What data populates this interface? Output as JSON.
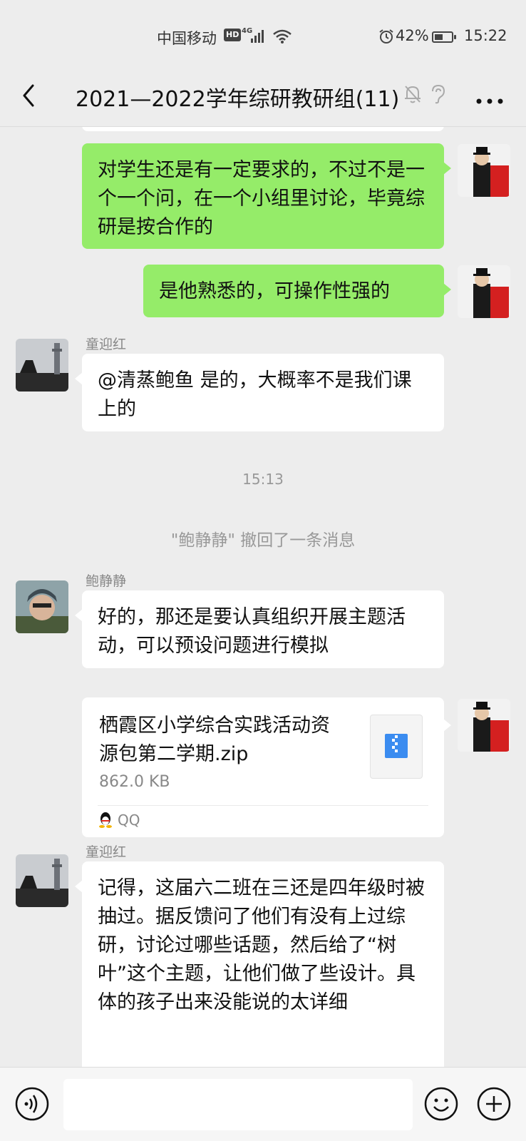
{
  "status_bar": {
    "carrier": "中国移动",
    "hd": "HD",
    "network": "4G",
    "battery": "42%",
    "battery_level": 0.42,
    "time": "15:22"
  },
  "header": {
    "title": "2021—2022学年综研教研组(11)",
    "icons": [
      "back-icon",
      "mute-bell-icon",
      "ear-icon",
      "more-icon"
    ]
  },
  "messages": [
    {
      "type": "text",
      "side": "right",
      "text": "对学生还是有一定要求的，不过不是一个一个问，在一个小组里讨论，毕竟综研是按合作的"
    },
    {
      "type": "text",
      "side": "right",
      "text": "是他熟悉的，可操作性强的"
    },
    {
      "type": "text",
      "side": "left",
      "sender": "童迎红",
      "text": "@清蒸鲍鱼  是的，大概率不是我们课上的"
    },
    {
      "type": "time",
      "text": "15:13"
    },
    {
      "type": "system",
      "text": "\"鲍静静\" 撤回了一条消息"
    },
    {
      "type": "text",
      "side": "left",
      "sender": "鲍静静",
      "text": "好的，那还是要认真组织开展主题活动，可以预设问题进行模拟"
    },
    {
      "type": "file",
      "side": "right",
      "file_name": "栖霞区小学综合实践活动资源包第二学期.zip",
      "file_size": "862.0 KB",
      "source": "QQ"
    },
    {
      "type": "text",
      "side": "left",
      "sender": "童迎红",
      "text": "记得，这届六二班在三还是四年级时被抽过。据反馈问了他们有没有上过综研，讨论过哪些话题，然后给了“树叶”这个主题，让他们做了些设计。具体的孩子出来没能说的太详细"
    }
  ],
  "input_bar": {
    "placeholder": "",
    "icons": [
      "voice-icon",
      "emoji-icon",
      "plus-icon"
    ]
  },
  "colors": {
    "background": "#ededed",
    "own_bubble": "#95ec69",
    "other_bubble": "#ffffff",
    "file_icon_accent": "#3b8cf0"
  }
}
